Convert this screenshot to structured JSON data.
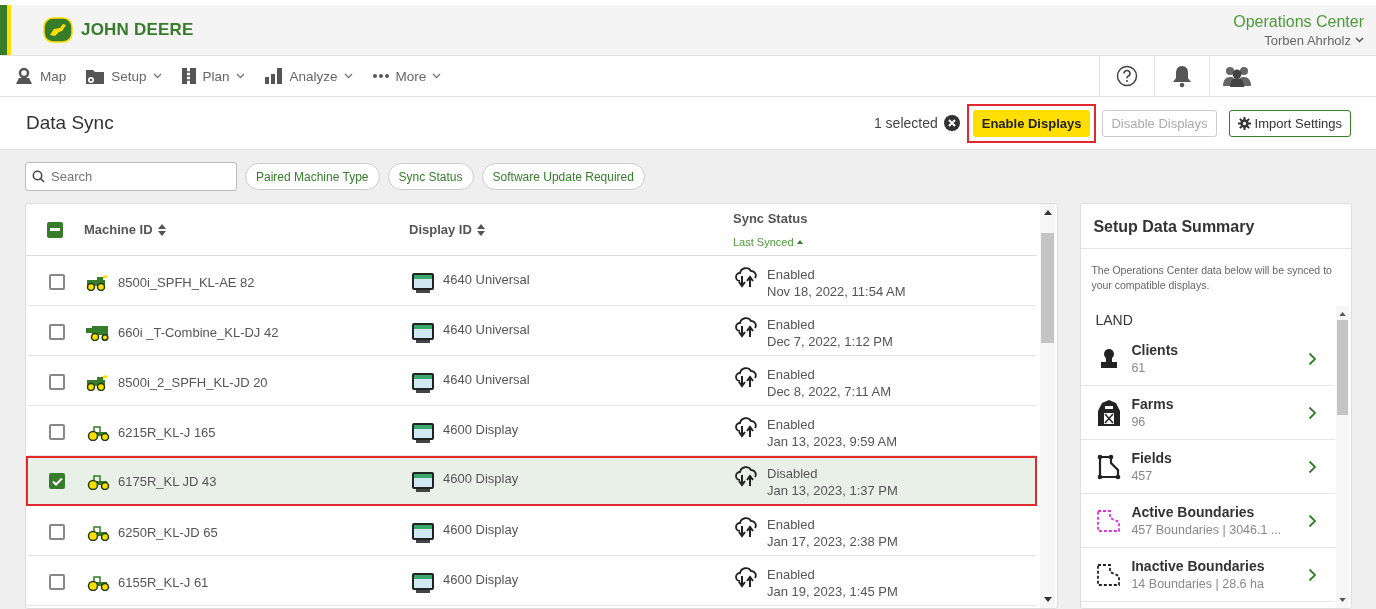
{
  "header": {
    "brand": "JOHN DEERE",
    "app_title": "Operations Center",
    "user": "Torben Ahrholz"
  },
  "nav": [
    {
      "label": "Map",
      "kind": "map",
      "dropdown": false
    },
    {
      "label": "Setup",
      "kind": "setup",
      "dropdown": true
    },
    {
      "label": "Plan",
      "kind": "plan",
      "dropdown": true
    },
    {
      "label": "Analyze",
      "kind": "analyze",
      "dropdown": true
    },
    {
      "label": "More",
      "kind": "more",
      "dropdown": true
    }
  ],
  "page": {
    "title": "Data Sync",
    "selection_count": "1 selected"
  },
  "actions": [
    {
      "label": "Enable Displays",
      "kind": "primary",
      "disabled": false,
      "highlighted": true
    },
    {
      "label": "Disable Displays",
      "kind": "secondary",
      "disabled": true,
      "highlighted": false
    },
    {
      "label": "Import Settings",
      "kind": "settings",
      "disabled": false,
      "highlighted": false
    }
  ],
  "search": {
    "placeholder": "Search"
  },
  "filters": [
    "Paired Machine Type",
    "Sync Status",
    "Software Update Required"
  ],
  "table": {
    "select_all": {
      "indeterminate": true
    },
    "columns": [
      {
        "label": "Machine ID",
        "sortable": true
      },
      {
        "label": "Display ID",
        "sortable": true
      },
      {
        "label": "Sync Status",
        "sortable": false,
        "sub_label": "Last Synced"
      }
    ],
    "rows": [
      {
        "machine": "8500i_SPFH_KL-AE 82",
        "kind": "harvester",
        "display": "4640 Universal",
        "status": "Enabled",
        "last_synced": "Nov 18, 2022, 11:54 AM",
        "selected": false
      },
      {
        "machine": "660i _T-Combine_KL-DJ 42",
        "kind": "combine",
        "display": "4640 Universal",
        "status": "Enabled",
        "last_synced": "Dec 7, 2022, 1:12 PM",
        "selected": false
      },
      {
        "machine": "8500i_2_SPFH_KL-JD 20",
        "kind": "harvester",
        "display": "4640 Universal",
        "status": "Enabled",
        "last_synced": "Dec 8, 2022, 7:11 AM",
        "selected": false
      },
      {
        "machine": "6215R_KL-J 165",
        "kind": "tractor",
        "display": "4600 Display",
        "status": "Enabled",
        "last_synced": "Jan 13, 2023, 9:59 AM",
        "selected": false
      },
      {
        "machine": "6175R_KL JD 43",
        "kind": "tractor",
        "display": "4600 Display",
        "status": "Disabled",
        "last_synced": "Jan 13, 2023, 1:37 PM",
        "selected": true
      },
      {
        "machine": "6250R_KL-JD 65",
        "kind": "tractor",
        "display": "4600 Display",
        "status": "Enabled",
        "last_synced": "Jan 17, 2023, 2:38 PM",
        "selected": false
      },
      {
        "machine": "6155R_KL-J 61",
        "kind": "tractor",
        "display": "4600 Display",
        "status": "Enabled",
        "last_synced": "Jan 19, 2023, 1:45 PM",
        "selected": false
      }
    ]
  },
  "summary": {
    "title": "Setup Data Summary",
    "description": "The Operations Center data below will be synced to your compatible displays.",
    "section": "LAND",
    "items": [
      {
        "label": "Clients",
        "detail": "61",
        "kind": "clients"
      },
      {
        "label": "Farms",
        "detail": "96",
        "kind": "farms"
      },
      {
        "label": "Fields",
        "detail": "457",
        "kind": "fields"
      },
      {
        "label": "Active Boundaries",
        "detail": "457 Boundaries | 3046.1 ...",
        "kind": "active"
      },
      {
        "label": "Inactive Boundaries",
        "detail": "14 Boundaries | 28.6 ha",
        "kind": "inactive"
      }
    ]
  }
}
